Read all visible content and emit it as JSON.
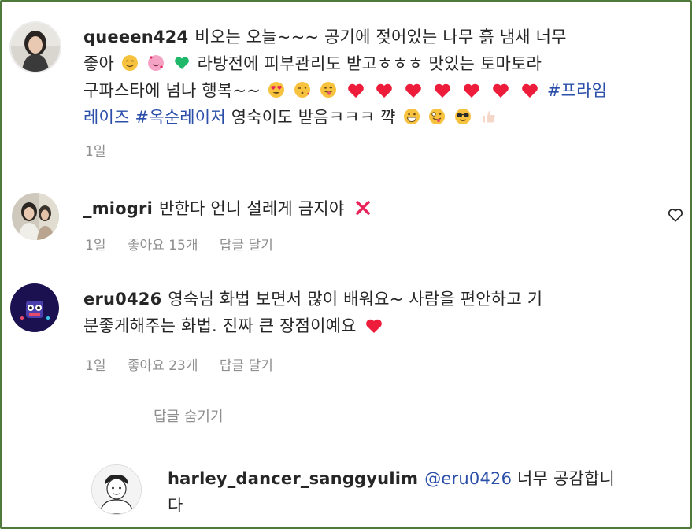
{
  "comments": [
    {
      "username": "queeen424",
      "text_1": "비오는 오늘~~~ 공기에 젖어있는 나무 흙 냄새 너무",
      "text_2a": "좋아",
      "text_2b": "라방전에 피부관리도 받고ㅎㅎㅎ 맛있는 토마토라",
      "text_3a": "구파스타에 넘나 행복~~",
      "hashtag_1": "#프라임",
      "hashtag_2": "레이즈",
      "hashtag_3": "#옥순레이저",
      "text_4": "영숙이도 받음ㅋㅋㅋ 꺅",
      "time": "1일"
    },
    {
      "username": "_miogri",
      "text": "반한다 언니 설레게 금지야",
      "time": "1일",
      "likes": "좋아요 15개",
      "reply_label": "답글 달기"
    },
    {
      "username": "eru0426",
      "text_1": "영숙님 화법 보면서 많이 배워요~ 사람을 편안하고 기",
      "text_2": "분좋게해주는 화법. 진짜 큰 장점이예요",
      "time": "1일",
      "likes": "좋아요 23개",
      "reply_label": "답글 달기"
    }
  ],
  "hide_replies_label": "답글 숨기기",
  "reply": {
    "username": "harley_dancer_sanggyulim",
    "mention": "@eru0426",
    "text_1": "너무 공감합니",
    "text_2": "다"
  },
  "colors": {
    "border": "#4f7a3a",
    "hashtag": "#2b4fa8",
    "heart": "#ed1c3a",
    "meta": "#8e8e8e"
  }
}
